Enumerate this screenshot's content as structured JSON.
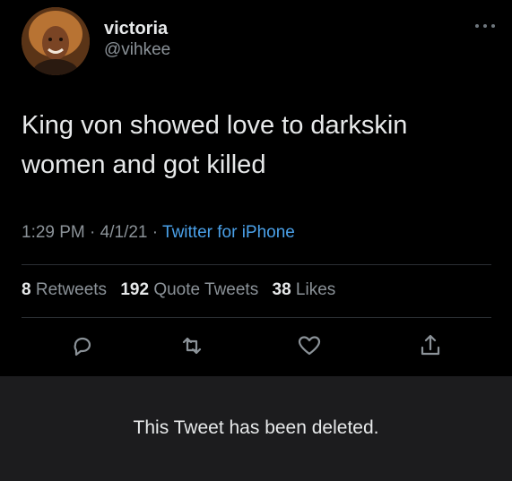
{
  "tweet": {
    "author": {
      "display_name": "victoria",
      "handle": "@vihkee",
      "avatar_icon": "profile-photo"
    },
    "more_icon": "more-horizontal-icon",
    "text": "King von  showed love to darkskin\nwomen and got killed",
    "time": "1:29 PM",
    "date": "4/1/21",
    "separator": "·",
    "source": "Twitter for iPhone",
    "stats": {
      "retweets_count": "8",
      "retweets_label": "Retweets",
      "quote_tweets_count": "192",
      "quote_tweets_label": "Quote Tweets",
      "likes_count": "38",
      "likes_label": "Likes"
    },
    "actions": [
      {
        "name": "reply",
        "icon": "reply-icon"
      },
      {
        "name": "retweet",
        "icon": "retweet-icon"
      },
      {
        "name": "like",
        "icon": "heart-icon"
      },
      {
        "name": "share",
        "icon": "share-icon"
      }
    ]
  },
  "banner": {
    "deleted_message": "This Tweet has been deleted."
  },
  "colors": {
    "background": "#000000",
    "text_primary": "#e7e9ea",
    "text_secondary": "#8b9298",
    "link": "#4aa0e8",
    "divider": "#2b2f33",
    "banner_background": "#1c1c1e"
  }
}
